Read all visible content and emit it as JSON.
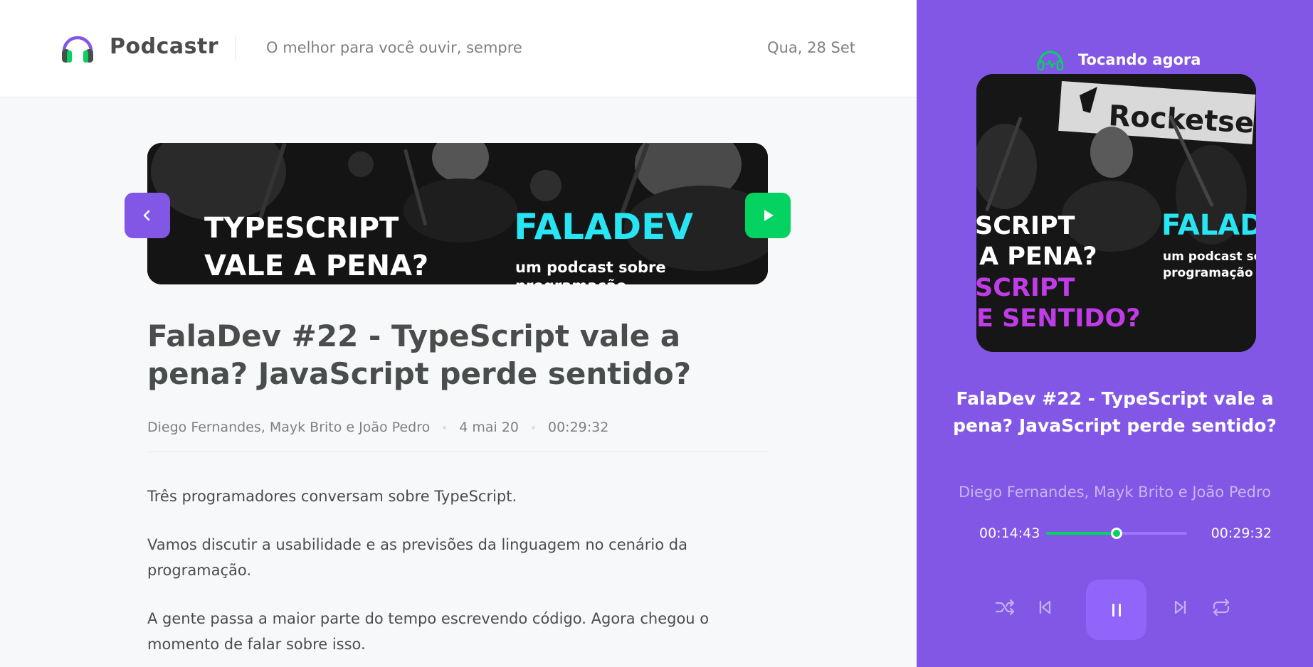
{
  "header": {
    "app_name": "Podcastr",
    "tagline": "O melhor para você ouvir, sempre",
    "date": "Qua, 28 Set"
  },
  "episode": {
    "title": "FalaDev #22 - TypeScript vale a pena? JavaScript perde sentido?",
    "members": "Diego Fernandes, Mayk Brito e João Pedro",
    "published": "4 mai 20",
    "duration": "00:29:32",
    "description": [
      "Três programadores conversam sobre TypeScript.",
      "Vamos discutir a usabilidade e as previsões da linguagem no cenário da programação.",
      "A gente passa a maior parte do tempo escrevendo código. Agora chegou o momento de falar sobre isso."
    ],
    "thumbnail_text": {
      "headline_1": "TYPESCRIPT",
      "headline_2": "VALE A PENA?",
      "brand": "FALADEV",
      "sub_1": "um podcast sobre",
      "sub_2": "programação"
    }
  },
  "player": {
    "label": "Tocando agora",
    "title": "FalaDev #22 - TypeScript vale a pena? JavaScript perde sentido?",
    "members": "Diego Fernandes, Mayk Brito e João Pedro",
    "current_time": "00:14:43",
    "total_time": "00:29:32",
    "progress": 0.5,
    "cover_text": {
      "brand_top": "Rocketse",
      "line_1": "SCRIPT",
      "line_2": "A PENA?",
      "line_3": "SCRIPT",
      "line_4": "E SENTIDO?",
      "brand": "FALAD",
      "sub_1": "um podcast sob",
      "sub_2": "programação"
    },
    "controls": [
      "shuffle-icon",
      "previous-icon",
      "pause-icon",
      "next-icon",
      "repeat-icon"
    ]
  },
  "colors": {
    "purple": "#8257e5",
    "green": "#04d361",
    "cyan": "#27e5f2",
    "magenta": "#c13ce8"
  }
}
